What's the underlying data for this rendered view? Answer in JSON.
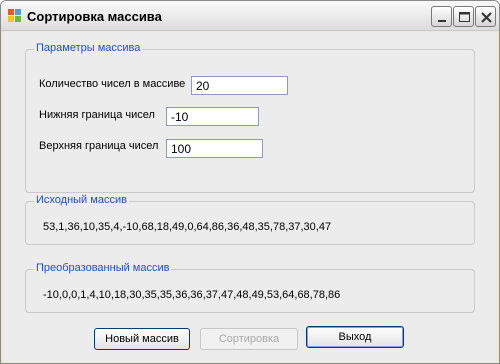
{
  "window": {
    "title": "Сортировка массива"
  },
  "params_group": {
    "legend": "Параметры массива",
    "count_label": "Количество чисел в массиве",
    "count_value": "20",
    "lower_label": "Нижняя граница чисел",
    "lower_value": "-10",
    "upper_label": "Верхняя граница чисел",
    "upper_value": "100"
  },
  "source_group": {
    "legend": "Исходный массив",
    "values": "53,1,36,10,35,4,-10,68,18,49,0,64,86,36,48,35,78,37,30,47"
  },
  "result_group": {
    "legend": "Преобразованный массив",
    "values": "-10,0,0,1,4,10,18,30,35,35,36,36,37,47,48,49,53,64,68,78,86"
  },
  "buttons": {
    "new_array": "Новый массив",
    "sort": "Сортировка",
    "exit": "Выход"
  }
}
